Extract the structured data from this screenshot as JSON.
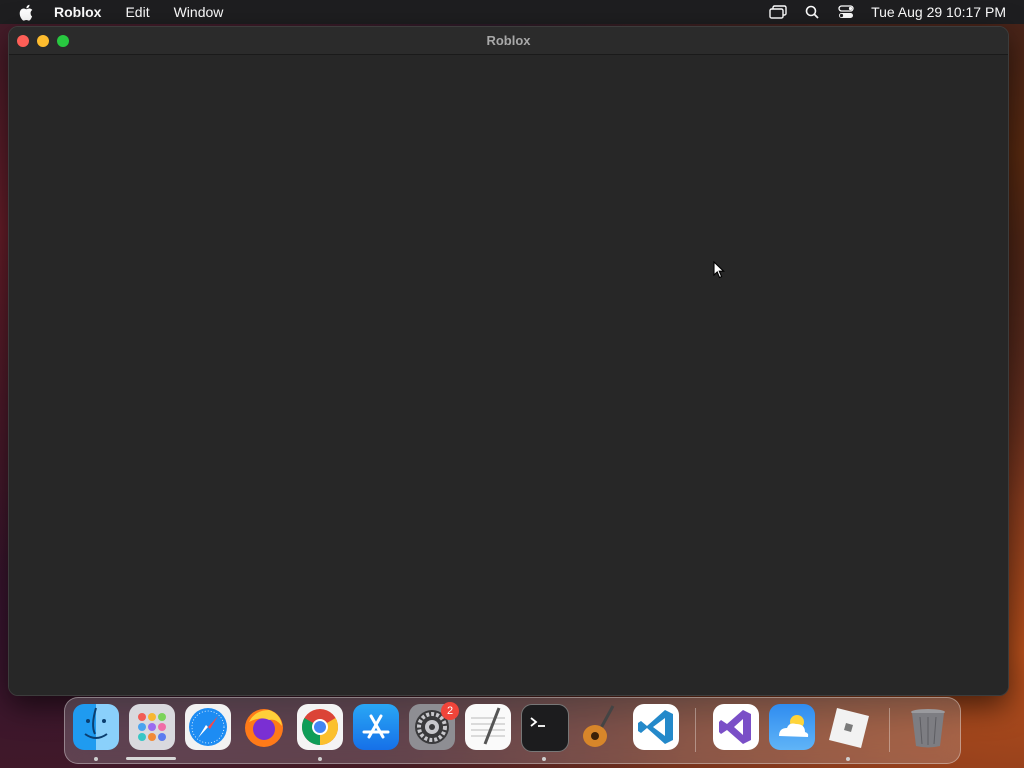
{
  "menubar": {
    "app_name": "Roblox",
    "items": [
      "Edit",
      "Window"
    ],
    "clock": "Tue Aug 29  10:17 PM",
    "status_icons": [
      "screen-mirroring-icon",
      "search-icon",
      "control-center-icon"
    ]
  },
  "window": {
    "title": "Roblox"
  },
  "dock": {
    "apps": [
      {
        "name": "Finder",
        "icon": "finder-icon",
        "running": true
      },
      {
        "name": "Launchpad",
        "icon": "launchpad-icon",
        "running": false
      },
      {
        "name": "Safari",
        "icon": "safari-icon",
        "running": false
      },
      {
        "name": "Firefox",
        "icon": "firefox-icon",
        "running": false
      },
      {
        "name": "Google Chrome",
        "icon": "chrome-icon",
        "running": true
      },
      {
        "name": "App Store",
        "icon": "app-store-icon",
        "running": false
      },
      {
        "name": "System Settings",
        "icon": "system-settings-icon",
        "running": false,
        "badge": "2"
      },
      {
        "name": "TextEdit",
        "icon": "textedit-icon",
        "running": false
      },
      {
        "name": "Terminal",
        "icon": "terminal-icon",
        "running": true
      },
      {
        "name": "GarageBand",
        "icon": "garageband-icon",
        "running": false
      },
      {
        "name": "Visual Studio Code",
        "icon": "vscode-icon",
        "running": false
      },
      {
        "name": "Visual Studio",
        "icon": "visual-studio-icon",
        "running": false
      },
      {
        "name": "Weather",
        "icon": "weather-icon",
        "running": false
      },
      {
        "name": "Roblox",
        "icon": "roblox-icon",
        "running": true
      },
      {
        "name": "Trash",
        "icon": "trash-icon",
        "running": false
      }
    ]
  },
  "colors": {
    "window_bg": "#272727",
    "menubar_bg": "#1e1e20",
    "badge": "#f0443a"
  }
}
